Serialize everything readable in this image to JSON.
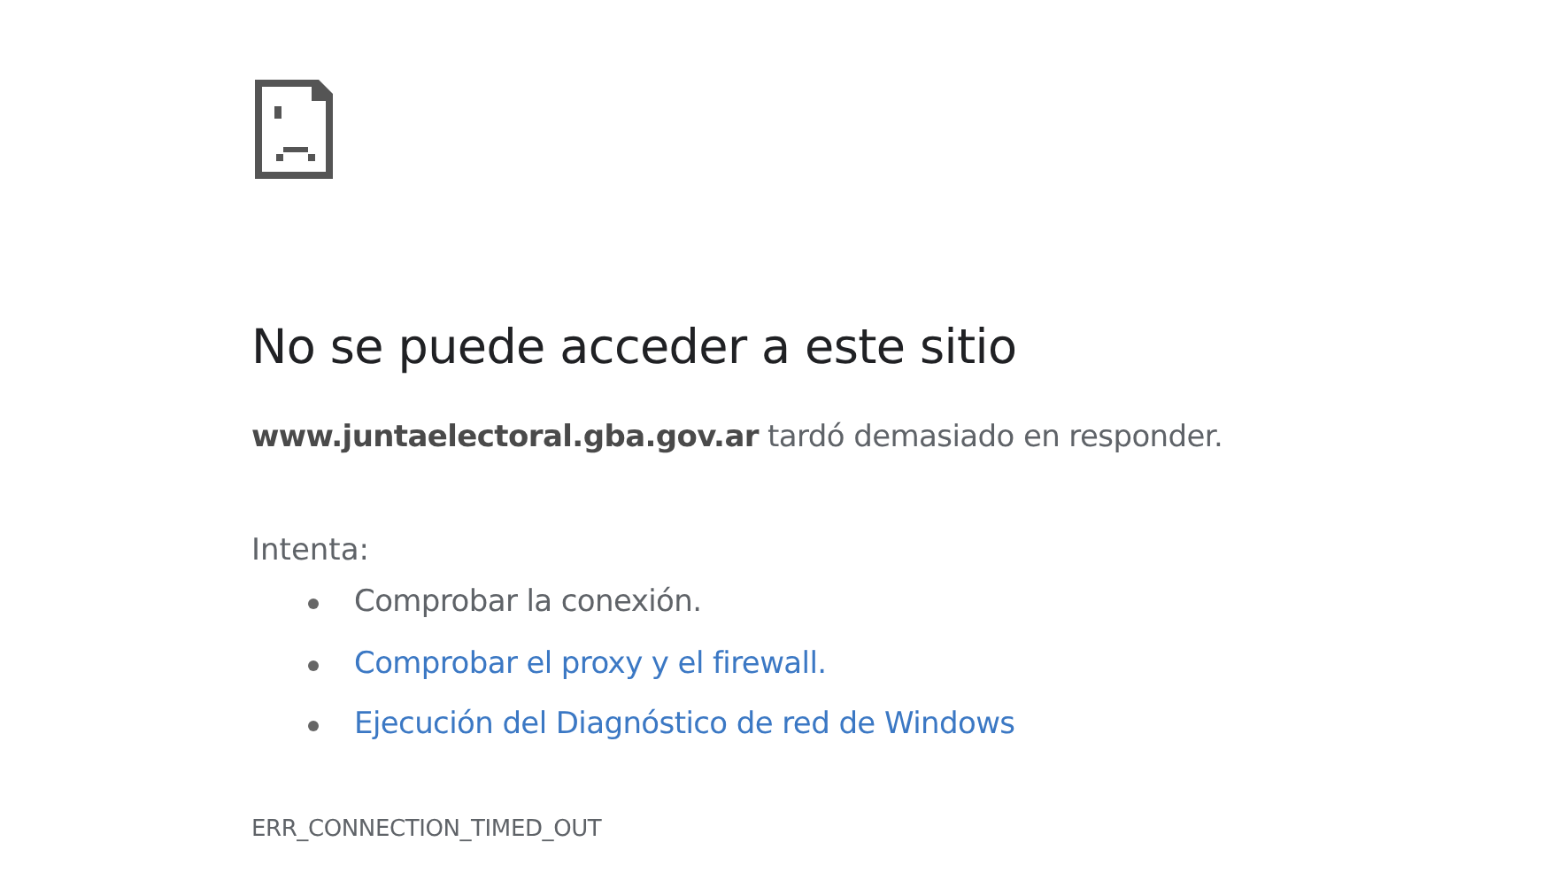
{
  "heading": "No se puede acceder a este sitio",
  "message": "**www.juntaelectoral.gba.gov.ar** tardó demasiado en responder.",
  "suggestions_label": "Intenta:",
  "suggestions": [
    {
      "kind": "text",
      "text": "Comprobar la conexión."
    },
    {
      "kind": "link",
      "text": "Comprobar el proxy y el firewall."
    },
    {
      "kind": "link",
      "text": "Ejecución del Diagnóstico de red de Windows"
    }
  ],
  "error_code": "ERR_CONNECTION_TIMED_OUT"
}
